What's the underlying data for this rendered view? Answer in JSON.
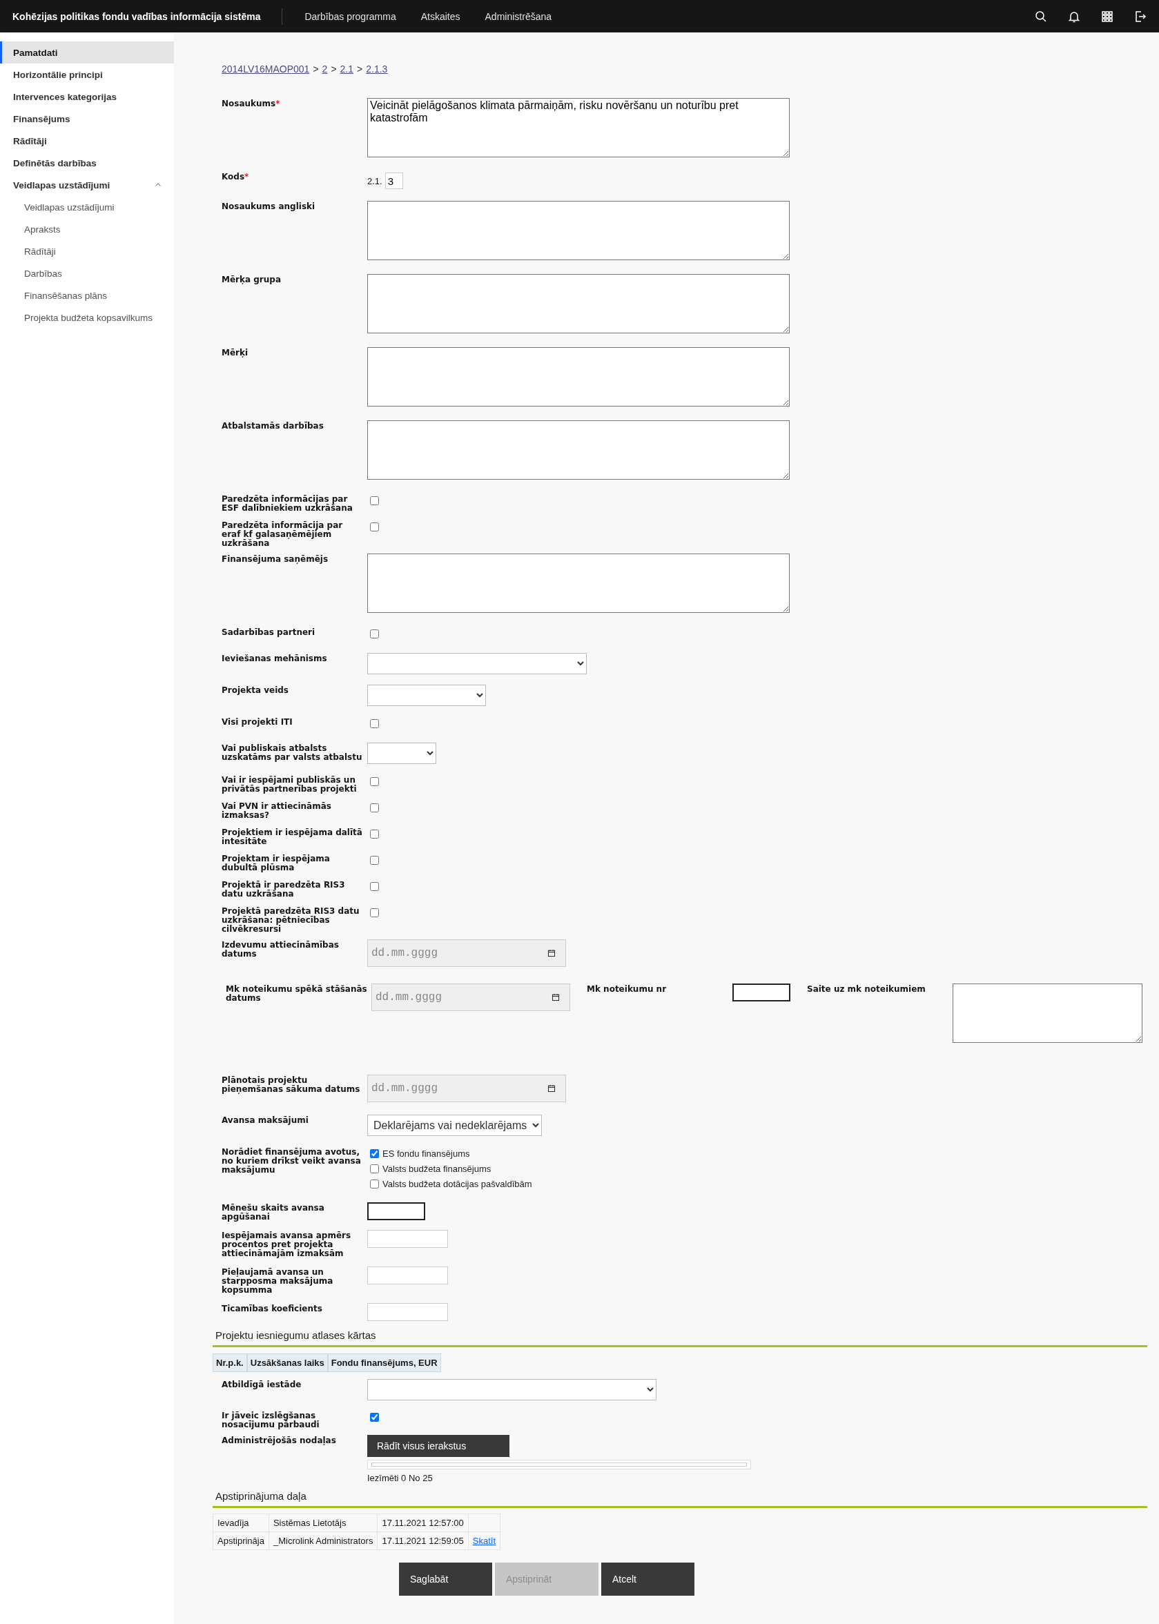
{
  "header": {
    "title": "Kohēzijas politikas fondu vadības informācija sistēma",
    "nav": [
      {
        "label": "Darbības programma"
      },
      {
        "label": "Atskaites"
      },
      {
        "label": "Administrēšana"
      }
    ]
  },
  "sidebar": {
    "items": [
      {
        "label": "Pamatdati",
        "selected": true
      },
      {
        "label": "Horizontālie principi",
        "selected": false
      },
      {
        "label": "Intervences kategorijas",
        "selected": false
      },
      {
        "label": "Finansējums",
        "selected": false
      },
      {
        "label": "Rādītāji",
        "selected": false
      },
      {
        "label": "Definētās darbības",
        "selected": false
      },
      {
        "label": "Veidlapas uzstādījumi",
        "selected": false,
        "expanded": true,
        "children": [
          {
            "label": "Veidlapas uzstādījumi",
            "selected": false
          },
          {
            "label": "Apraksts",
            "selected": false
          },
          {
            "label": "Rādītāji",
            "selected": false
          },
          {
            "label": "Darbības",
            "selected": false
          },
          {
            "label": "Finansēšanas plāns",
            "selected": false
          },
          {
            "label": "Projekta budžeta kopsavilkums",
            "selected": false
          }
        ]
      }
    ]
  },
  "breadcrumb": [
    {
      "label": "2014LV16MAOP001"
    },
    {
      "label": "2"
    },
    {
      "label": "2.1"
    },
    {
      "label": "2.1.3"
    }
  ],
  "breadcrumb_separator": ">",
  "fields": [
    {
      "kind": "textarea",
      "label": "Nosaukums",
      "required_mark": "*",
      "value": "Veicināt pielāgošanos klimata pārmaiņām, risku novēršanu un noturību pret katastrofām"
    },
    {
      "kind": "code",
      "label": "Kods",
      "required_mark": "*",
      "prefix": "2.1.",
      "value": "3"
    },
    {
      "kind": "textarea",
      "label": "Nosaukums angliski"
    },
    {
      "kind": "textarea",
      "label": "Mērķa grupa"
    },
    {
      "kind": "textarea",
      "label": "Mērķi"
    },
    {
      "kind": "textarea",
      "label": "Atbalstamās darbības"
    },
    {
      "kind": "checkbox",
      "label": "Paredzēta informācijas par ESF dalībniekiem uzkrāšana",
      "checked": false
    },
    {
      "kind": "checkbox",
      "label": "Paredzēta informācija par eraf kf galasaņēmējiem uzkrāšana",
      "checked": false
    },
    {
      "kind": "textarea",
      "label": "Finansējuma saņēmējs"
    },
    {
      "kind": "checkbox",
      "label": "Sadarbības partneri",
      "checked": false
    },
    {
      "kind": "select",
      "label": "Ieviešanas mehānisms"
    },
    {
      "kind": "select",
      "label": "Projekta veids"
    },
    {
      "kind": "checkbox",
      "label": "Visi projekti ITI",
      "checked": false
    },
    {
      "kind": "select",
      "label": "Vai publiskais atbalsts uzskatāms par valsts atbalstu"
    },
    {
      "kind": "checkbox",
      "label": "Vai ir iespējami publiskās un privātās partnerības projekti",
      "checked": false
    },
    {
      "kind": "checkbox",
      "label": "Vai PVN ir attiecināmās izmaksas?",
      "checked": false
    },
    {
      "kind": "checkbox",
      "label": "Projektiem ir iespējama dalītā intesitāte",
      "checked": false
    },
    {
      "kind": "checkbox",
      "label": "Projektam ir iespējama dubultā plūsma",
      "checked": false
    },
    {
      "kind": "checkbox",
      "label": "Projektā ir paredzēta RIS3 datu uzkrāšana",
      "checked": false
    },
    {
      "kind": "checkbox",
      "label": "Projektā paredzēta RIS3 datu uzkrāšana: pētniecības cilvēkresursi",
      "checked": false
    },
    {
      "kind": "date",
      "label": "Izdevumu attiecināmības datums",
      "placeholder": "dd.mm.gggg"
    },
    {
      "kind": "group",
      "items": [
        {
          "kind": "date",
          "label": "Mk noteikumu spēkā stāšanās datums",
          "placeholder": "dd.mm.gggg"
        },
        {
          "kind": "number",
          "label": "Mk noteikumu nr"
        },
        {
          "kind": "textarea",
          "label": "Saite uz mk noteikumiem"
        }
      ]
    },
    {
      "kind": "date",
      "label": "Plānotais projektu pieņemšanas sākuma datums",
      "placeholder": "dd.mm.gggg"
    },
    {
      "kind": "select",
      "label": "Avansa maksājumi",
      "value": "Deklarējams vai nedeklarējams"
    },
    {
      "kind": "checklist",
      "label": "Norādiet finansējuma avotus, no kuriem drīkst veikt avansa maksājumu",
      "options": [
        {
          "label": "ES fondu finansējums",
          "checked": true
        },
        {
          "label": "Valsts budžeta finansējums",
          "checked": false
        },
        {
          "label": "Valsts budžeta dotācijas pašvaldībām",
          "checked": false
        }
      ]
    },
    {
      "kind": "number",
      "label": "Mēnešu skaits avansa apgūšanai"
    },
    {
      "kind": "text",
      "label": "Iespējamais avansa apmērs procentos pret projekta attiecināmajām izmaksām"
    },
    {
      "kind": "text",
      "label": "Pieļaujamā avansa un starpposma maksājuma kopsumma"
    },
    {
      "kind": "text",
      "label": "Ticamības koeficients"
    }
  ],
  "selection_rounds": {
    "title": "Projektu iesniegumu atlases kārtas",
    "columns": [
      "Nr.p.k.",
      "Uzsākšanas laiks",
      "Fondu finansējums, EUR"
    ],
    "fields": [
      {
        "kind": "select",
        "label": "Atbildīgā iestāde"
      },
      {
        "kind": "checkbox",
        "label": "Ir jāveic izslēgšanas nosacījumu pārbaudi",
        "checked": true
      },
      {
        "kind": "listbox",
        "label": "Administrējošās nodaļas",
        "button": "Rādīt visus ierakstus",
        "counter": "Iezīmēti 0 No 25"
      }
    ]
  },
  "approval": {
    "title": "Apstiprinājuma daļa",
    "rows": [
      {
        "role": "Ievadīja",
        "user": "Sistēmas Lietotājs",
        "time": "17.11.2021 12:57:00"
      },
      {
        "role": "Apstiprināja",
        "user": "_Microlink Administrators",
        "time": "17.11.2021 12:59:05",
        "link": "Skatīt"
      }
    ]
  },
  "buttons": [
    {
      "label": "Saglabāt",
      "disabled": false
    },
    {
      "label": "Apstiprināt",
      "disabled": true
    },
    {
      "label": "Atcelt",
      "disabled": false
    }
  ]
}
